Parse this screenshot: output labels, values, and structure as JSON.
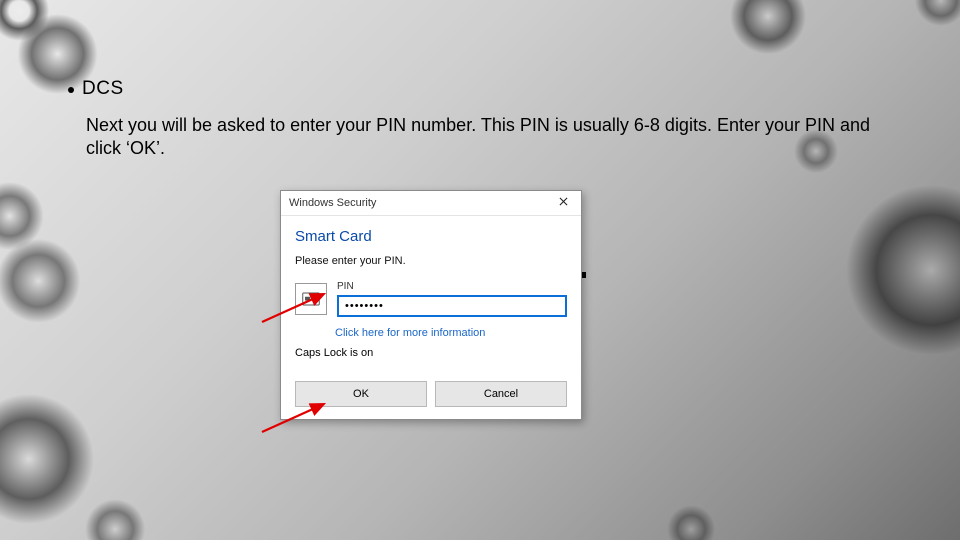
{
  "slide": {
    "title": "DCS",
    "body": "Next you will be asked to enter your PIN number. This PIN is usually 6-8 digits. Enter your PIN and click ‘OK’."
  },
  "dialog": {
    "window_title": "Windows Security",
    "heading": "Smart Card",
    "prompt": "Please enter your PIN.",
    "pin_label": "PIN",
    "pin_value": "••••••••",
    "more_info_link": "Click here for more information",
    "caps_lock_warning": "Caps Lock is on",
    "ok_label": "OK",
    "cancel_label": "Cancel"
  }
}
